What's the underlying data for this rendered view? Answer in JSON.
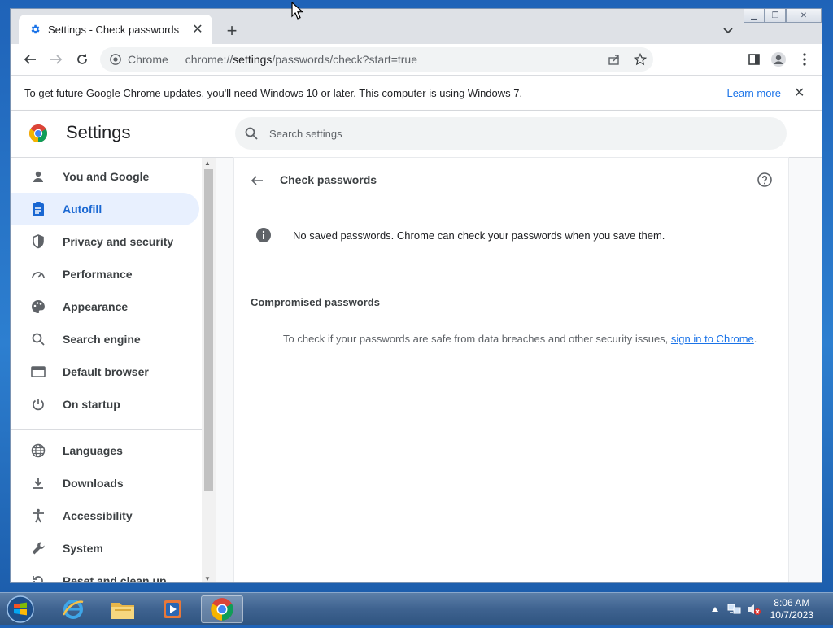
{
  "tab": {
    "title": "Settings - Check passwords",
    "close": "✕"
  },
  "newtab": "+",
  "window_controls": {
    "minimize": "▁",
    "restore": "❐",
    "close": "✕"
  },
  "omnibox": {
    "site_name": "Chrome",
    "url_prefix": "chrome://",
    "url_host": "settings",
    "url_path": "/passwords/check?start=true"
  },
  "infobar": {
    "message": "To get future Google Chrome updates, you'll need Windows 10 or later. This computer is using Windows 7.",
    "learn_more": "Learn more",
    "close": "✕"
  },
  "settings": {
    "title": "Settings",
    "search_placeholder": "Search settings"
  },
  "sidebar": {
    "items": [
      {
        "label": "You and Google",
        "icon": "person-icon",
        "active": false
      },
      {
        "label": "Autofill",
        "icon": "clipboard-icon",
        "active": true
      },
      {
        "label": "Privacy and security",
        "icon": "shield-icon",
        "active": false
      },
      {
        "label": "Performance",
        "icon": "speedometer-icon",
        "active": false
      },
      {
        "label": "Appearance",
        "icon": "palette-icon",
        "active": false
      },
      {
        "label": "Search engine",
        "icon": "search-icon",
        "active": false
      },
      {
        "label": "Default browser",
        "icon": "browser-window-icon",
        "active": false
      },
      {
        "label": "On startup",
        "icon": "power-icon",
        "active": false
      },
      {
        "label": "Languages",
        "icon": "globe-icon",
        "active": false
      },
      {
        "label": "Downloads",
        "icon": "download-icon",
        "active": false
      },
      {
        "label": "Accessibility",
        "icon": "accessibility-icon",
        "active": false
      },
      {
        "label": "System",
        "icon": "wrench-icon",
        "active": false
      },
      {
        "label": "Reset and clean up",
        "icon": "reset-icon",
        "active": false
      }
    ]
  },
  "content": {
    "page_title": "Check passwords",
    "status_message": "No saved passwords. Chrome can check your passwords when you save them.",
    "section_title": "Compromised passwords",
    "description": "To check if your passwords are safe from data breaches and other security issues, ",
    "signin_link": "sign in to Chrome",
    "description_end": "."
  },
  "taskbar": {
    "time": "8:06 AM",
    "date": "10/7/2023",
    "apps": [
      "internet-explorer-icon",
      "file-explorer-icon",
      "media-player-icon",
      "chrome-icon"
    ]
  },
  "colors": {
    "accent": "#1a73e8",
    "active_nav_bg": "#e8f0fe",
    "active_nav_text": "#1967d2"
  }
}
